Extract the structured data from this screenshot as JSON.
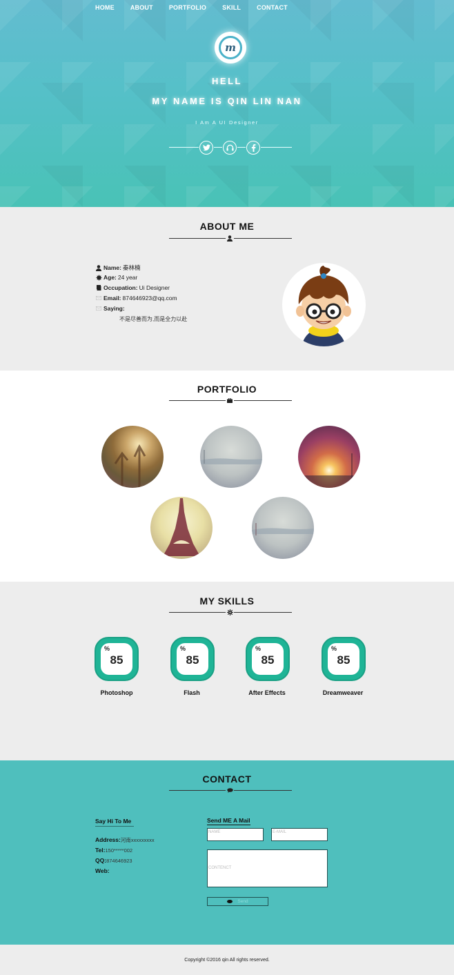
{
  "nav": {
    "items": [
      "HOME",
      "ABOUT",
      "PORTFOLIO",
      "SKILL",
      "CONTACT"
    ]
  },
  "hero": {
    "logo_letter": "m",
    "hello": "HELL",
    "name": "MY NAME IS QIN LIN NAN",
    "subtitle": "I Am A UI Designer",
    "social_icons": [
      "twitter-icon",
      "headphones-icon",
      "facebook-icon"
    ]
  },
  "about": {
    "title": "ABOUT ME",
    "rows": [
      {
        "icon": "user-icon",
        "label": "Name:",
        "value": "秦林楠"
      },
      {
        "icon": "leaf-icon",
        "label": "Age:",
        "value": " 24 year"
      },
      {
        "icon": "book-icon",
        "label": "Occupation:",
        "value": "Ui Designer"
      },
      {
        "icon": "envelope-icon",
        "label": "Email:",
        "value": "874646923@qq.com"
      },
      {
        "icon": "envelope-icon",
        "label": "Saying:",
        "value": ""
      }
    ],
    "saying": "不是尽善而为,而是全力以赴"
  },
  "portfolio": {
    "title": "PORTFOLIO"
  },
  "skills": {
    "title": "MY SKILLS",
    "items": [
      {
        "name": "Photoshop",
        "value": "85",
        "unit": "%"
      },
      {
        "name": "Flash",
        "value": "85",
        "unit": "%"
      },
      {
        "name": "After Effects",
        "value": "85",
        "unit": "%"
      },
      {
        "name": "Dreamweaver",
        "value": "85",
        "unit": "%"
      }
    ]
  },
  "contact": {
    "title": "CONTACT",
    "say_hi": "Say Hi To Me",
    "address_label": "Address:",
    "address_value": "河南xxxxxxxxx",
    "tel_label": "Tel:",
    "tel_value": "150*****002",
    "qq_label": "QQ:",
    "qq_value": "874646923",
    "web_label": "Web:",
    "send_head": "Send ME A Mail",
    "name_placeholder": "NAME",
    "email_placeholder": "E-MAIL",
    "content_placeholder": "CONTENCT",
    "send_label": "Send"
  },
  "footer": {
    "copyright": "Copyright ©2016 qin All rights reserved."
  },
  "colors": {
    "hero_top": "#63bcd0",
    "hero_bottom": "#49c2b6",
    "skill_green": "#1fb496",
    "contact_bg": "#4fbfbd"
  }
}
